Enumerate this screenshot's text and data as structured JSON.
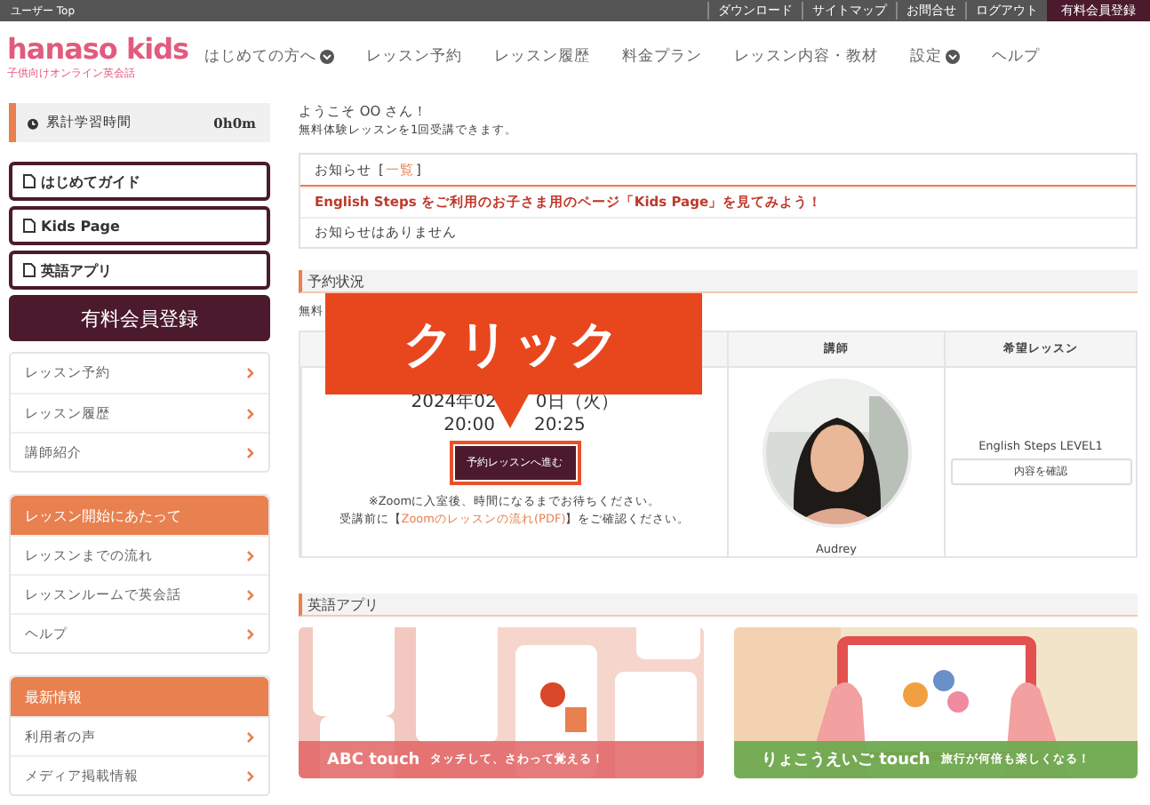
{
  "top_bar": {
    "user_label": "ユーザー Top",
    "links": [
      "ダウンロード",
      "サイトマップ",
      "お問合せ",
      "ログアウト"
    ],
    "register": "有料会員登録"
  },
  "header": {
    "logo": "hanaso kids",
    "logo_sub": "子供向けオンライン英会話",
    "nav": [
      {
        "label": "はじめての方へ",
        "dropdown": true
      },
      {
        "label": "レッスン予約",
        "dropdown": false
      },
      {
        "label": "レッスン履歴",
        "dropdown": false
      },
      {
        "label": "料金プラン",
        "dropdown": false
      },
      {
        "label": "レッスン内容・教材",
        "dropdown": false
      },
      {
        "label": "設定",
        "dropdown": true
      },
      {
        "label": "ヘルプ",
        "dropdown": false
      }
    ]
  },
  "sidebar": {
    "study_time": {
      "label": "累計学習時間",
      "value": "0h0m"
    },
    "guides": [
      "はじめてガイド",
      "Kids Page",
      "英語アプリ"
    ],
    "register": "有料会員登録",
    "sections": [
      {
        "items": [
          "レッスン予約",
          "レッスン履歴",
          "講師紹介"
        ]
      },
      {
        "title": "レッスン開始にあたって",
        "items": [
          "レッスンまでの流れ",
          "レッスンルームで英会話",
          "ヘルプ"
        ]
      },
      {
        "title": "最新情報",
        "items": [
          "利用者の声",
          "メディア掲載情報"
        ]
      }
    ]
  },
  "welcome": {
    "line1": "ようこそ OO さん！",
    "line2": "無料体験レッスンを1回受講できます。"
  },
  "notices": {
    "title": "お知らせ",
    "brackets": [
      "[",
      "]"
    ],
    "link": "一覧",
    "headline": "English Steps をご利用のお子さま用のページ「Kids Page」を見てみよう！",
    "message": "お知らせはありません"
  },
  "reservation": {
    "title": "予約状況",
    "note": "無料",
    "columns": [
      "",
      "講師",
      "希望レッスン"
    ],
    "date_parts": [
      "2024年02",
      "0日（火）"
    ],
    "time_parts": [
      "20:00",
      "20:25"
    ],
    "enter_button": "予約レッスンへ進む",
    "notice1": "※Zoomに入室後、時間になるまでお待ちください。",
    "notice2_before": "受講前に【",
    "notice2_link": "Zoomのレッスンの流れ(PDF)",
    "notice2_after": "】をご確認ください。",
    "teacher": "Audrey",
    "lesson": "English Steps LEVEL1",
    "lesson_button": "内容を確認"
  },
  "callout": {
    "text": "クリック"
  },
  "apps": {
    "title": "英語アプリ",
    "banners": [
      {
        "name": "ABC touch",
        "tagline": "タッチして、さわって覚える！",
        "kind": "phones"
      },
      {
        "name": "りょこうえいご touch",
        "tagline": "旅行が何倍も楽しくなる！",
        "kind": "tablet"
      }
    ]
  }
}
